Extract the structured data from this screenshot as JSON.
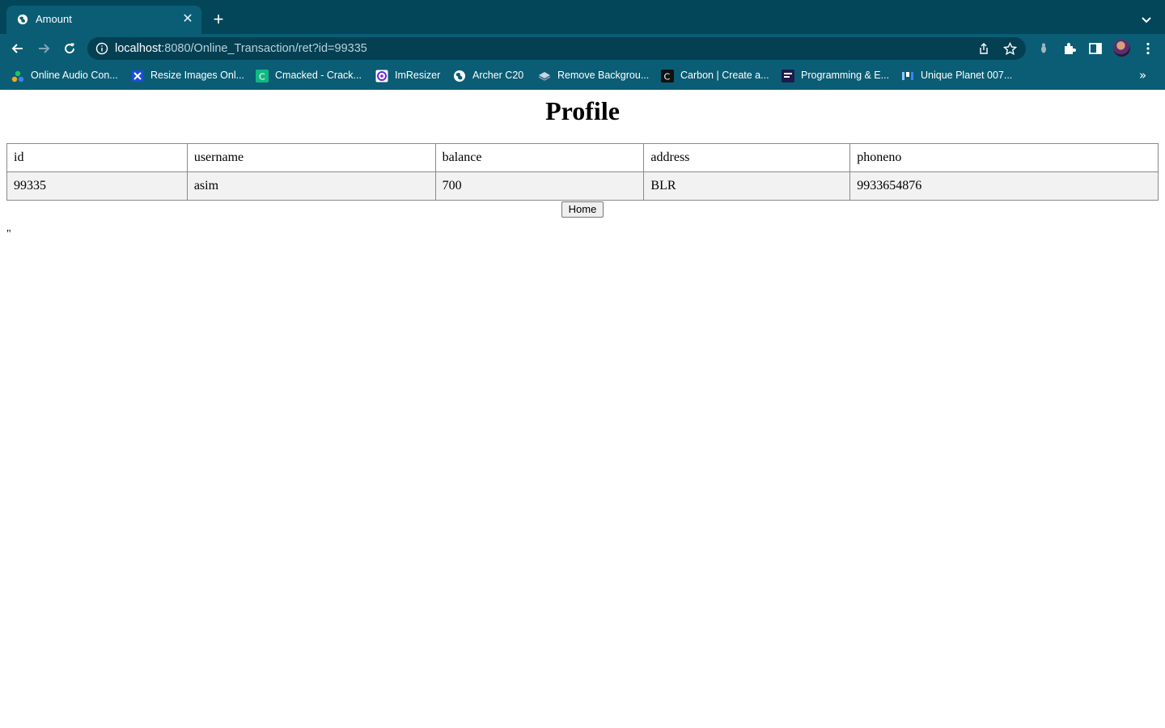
{
  "browser": {
    "tab": {
      "title": "Amount",
      "favicon": "globe-icon"
    },
    "url": {
      "host": "localhost",
      "rest": ":8080/Online_Transaction/ret?id=99335"
    },
    "bookmarks": [
      {
        "label": "Online Audio Con...",
        "icon": "audio-converter-icon"
      },
      {
        "label": "Resize Images Onl...",
        "icon": "resize-images-icon"
      },
      {
        "label": "Cmacked - Crack...",
        "icon": "c-letter-icon"
      },
      {
        "label": "ImResizer",
        "icon": "imresizer-icon"
      },
      {
        "label": "Archer C20",
        "icon": "globe-icon"
      },
      {
        "label": "Remove Backgrou...",
        "icon": "layers-icon"
      },
      {
        "label": "Carbon | Create a...",
        "icon": "carbon-icon"
      },
      {
        "label": "Programming & E...",
        "icon": "programming-icon"
      },
      {
        "label": "Unique Planet 007...",
        "icon": "unique-planet-icon"
      }
    ],
    "bookmarks_more": "»"
  },
  "page": {
    "title": "Profile",
    "table": {
      "headers": [
        "id",
        "username",
        "balance",
        "address",
        "phoneno"
      ],
      "rows": [
        [
          "99335",
          "asim",
          "700",
          "BLR",
          "9933654876"
        ]
      ]
    },
    "home_button": "Home",
    "stray_text": "\""
  }
}
